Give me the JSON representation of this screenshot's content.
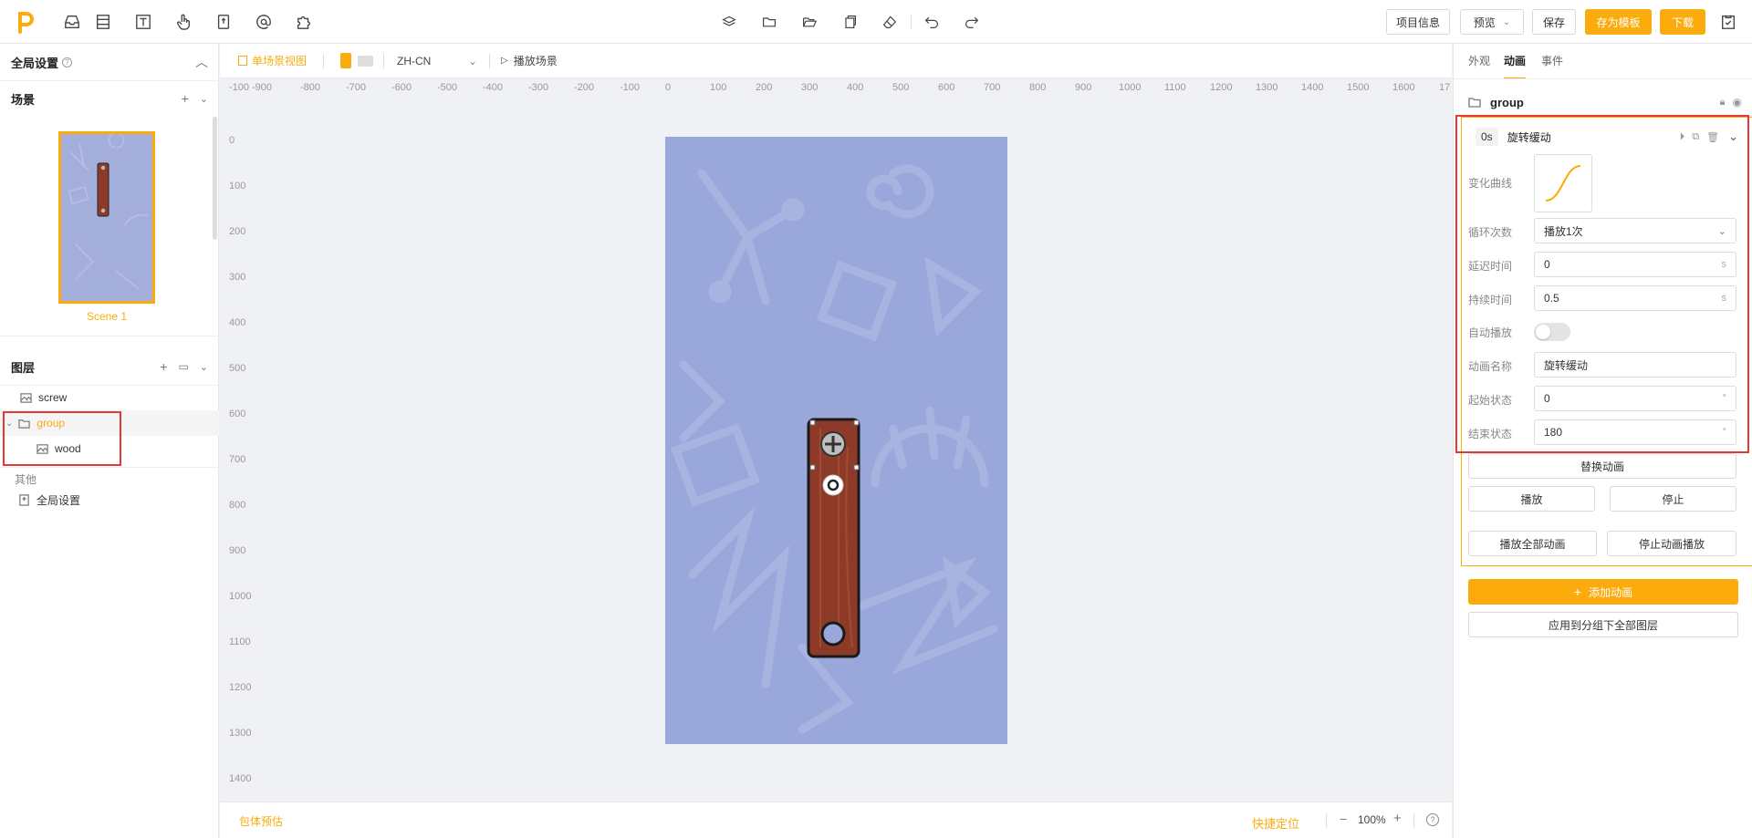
{
  "toolbar": {
    "project_info": "项目信息",
    "preview": "预览",
    "save": "保存",
    "save_template": "存为模板",
    "download": "下载"
  },
  "left": {
    "global_settings_title": "全局设置",
    "scene_section": "场景",
    "scene_name": "Scene 1",
    "layers_section": "图层",
    "layers": [
      {
        "name": "screw",
        "icon": "image-icon"
      },
      {
        "name": "group",
        "icon": "folder-icon"
      },
      {
        "name": "wood",
        "icon": "image-icon"
      }
    ],
    "other_section": "其他",
    "other_item": "全局设置"
  },
  "canvas": {
    "single_scene_view": "单场景视图",
    "language": "ZH-CN",
    "play_scene": "播放场景",
    "ruler_h": [
      "-100",
      "-900",
      "-800",
      "-700",
      "-600",
      "-500",
      "-400",
      "-300",
      "-200",
      "-100",
      "0",
      "100",
      "200",
      "300",
      "400",
      "500",
      "600",
      "700",
      "800",
      "900",
      "1000",
      "1100",
      "1200",
      "1300",
      "1400",
      "1500",
      "1600",
      "17"
    ],
    "ruler_v": [
      "0",
      "100",
      "200",
      "300",
      "400",
      "500",
      "600",
      "700",
      "800",
      "900",
      "1000",
      "1100",
      "1200",
      "1300",
      "1400"
    ],
    "package_estimate": "包体预估",
    "quick_locate": "快捷定位",
    "zoom": "100%",
    "zoom_minus": "−",
    "zoom_plus": "+"
  },
  "right": {
    "tabs": [
      "外观",
      "动画",
      "事件"
    ],
    "active_tab": "动画",
    "object_name": "group",
    "animation": {
      "time_badge": "0s",
      "name_header": "旋转缓动",
      "curve_label": "变化曲线",
      "loop_label": "循环次数",
      "loop_value": "播放1次",
      "delay_label": "延迟时间",
      "delay_value": "0",
      "delay_unit": "s",
      "duration_label": "持续时间",
      "duration_value": "0.5",
      "duration_unit": "s",
      "autoplay_label": "自动播放",
      "autoplay": false,
      "anim_name_label": "动画名称",
      "anim_name_value": "旋转缓动",
      "start_label": "起始状态",
      "start_value": "0",
      "end_label": "结束状态",
      "end_value": "180",
      "degree_unit": "°"
    },
    "replace_anim": "替换动画",
    "play": "播放",
    "stop": "停止",
    "play_all": "播放全部动画",
    "stop_all": "停止动画播放",
    "add_anim": "添加动画",
    "apply_group": "应用到分组下全部图层"
  },
  "colors": {
    "accent": "#fcab0c",
    "highlight_box": "#e53935",
    "stage_bg": "#9aa7db",
    "wood": "#8e3a28"
  }
}
